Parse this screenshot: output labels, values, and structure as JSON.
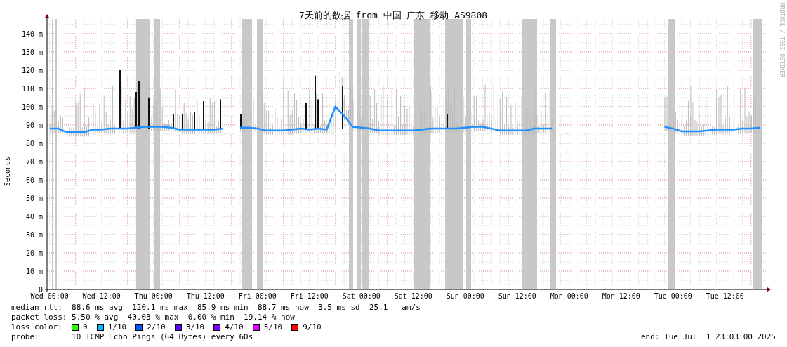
{
  "chart": {
    "credit": "RRDTOOL / TOBI OETIKER",
    "chart_data": {
      "type": "line",
      "title": "7天前的数据 from 中国 广东 移动 AS9808",
      "ylabel": "Seconds",
      "categories": [
        "Wed 00:00",
        null,
        null,
        null,
        null,
        null,
        "Wed 12:00",
        null,
        null,
        null,
        null,
        null,
        "Thu 00:00",
        null,
        null,
        null,
        null,
        null,
        "Thu 12:00",
        null,
        null,
        null,
        null,
        null,
        "Fri 00:00",
        null,
        null,
        null,
        null,
        null,
        "Fri 12:00",
        null,
        null,
        null,
        null,
        null,
        "Sat 00:00",
        null,
        null,
        null,
        null,
        null,
        "Sat 12:00",
        null,
        null,
        null,
        null,
        null,
        "Sun 00:00",
        null,
        null,
        null,
        null,
        null,
        "Sun 12:00",
        null,
        null,
        null,
        null,
        null,
        "Mon 00:00",
        null,
        null,
        null,
        null,
        null,
        "Mon 12:00",
        null,
        null,
        null,
        null,
        null,
        "Tue 00:00",
        null,
        null,
        null,
        null,
        null,
        "Tue 12:00",
        null,
        null,
        null,
        null
      ],
      "series": [
        {
          "name": "median rtt:",
          "color": "#1e90ff",
          "values": [
            88,
            88,
            86,
            86,
            86,
            87.5,
            87.5,
            88,
            88,
            88,
            88.5,
            89,
            89,
            89,
            88.5,
            87.5,
            87.5,
            87.5,
            87.5,
            87.5,
            88,
            null,
            88.5,
            88.5,
            88,
            87,
            87,
            87,
            87.5,
            88,
            87.5,
            88,
            87.5,
            100,
            95,
            89,
            88.5,
            88,
            87,
            87,
            87,
            87,
            87,
            87.5,
            88,
            88,
            88,
            88,
            88.5,
            89,
            89,
            88,
            87,
            87,
            87,
            87,
            88,
            88,
            88,
            null,
            null,
            null,
            null,
            null,
            null,
            null,
            null,
            null,
            null,
            null,
            null,
            89,
            88,
            86.5,
            86.5,
            86.5,
            87,
            87.5,
            87.5,
            87.5,
            88,
            88,
            88.5
          ]
        }
      ],
      "grid": true,
      "ylim": [
        0,
        148
      ],
      "yticks": [
        {
          "value": 0,
          "label": "0"
        },
        {
          "value": 10,
          "label": "10 m"
        },
        {
          "value": 20,
          "label": "20 m"
        },
        {
          "value": 30,
          "label": "30 m"
        },
        {
          "value": 40,
          "label": "40 m"
        },
        {
          "value": 50,
          "label": "50 m"
        },
        {
          "value": 60,
          "label": "60 m"
        },
        {
          "value": 70,
          "label": "70 m"
        },
        {
          "value": 80,
          "label": "80 m"
        },
        {
          "value": 90,
          "label": "90 m"
        },
        {
          "value": 100,
          "label": "100 m"
        },
        {
          "value": 110,
          "label": "110 m"
        },
        {
          "value": 120,
          "label": "120 m"
        },
        {
          "value": 130,
          "label": "130 m"
        },
        {
          "value": 140,
          "label": "140 m"
        }
      ]
    }
  },
  "legend": {
    "median_rtt": "88.6 ms avg  120.1 ms max  85.9 ms min  88.7 ms now  3.5 ms sd  25.1   am/s",
    "packet_loss_label": "packet loss:",
    "packet_loss": "5.50 % avg  40.03 % max  0.00 % min  19.14 % now",
    "loss_color_label": "loss color:",
    "loss_colors": [
      {
        "label": "0",
        "color": "#26ff00"
      },
      {
        "label": "1/10",
        "color": "#00b8ff"
      },
      {
        "label": "2/10",
        "color": "#0059ff"
      },
      {
        "label": "3/10",
        "color": "#5e00ff"
      },
      {
        "label": "4/10",
        "color": "#7e00ff"
      },
      {
        "label": "5/10",
        "color": "#dd00ff"
      },
      {
        "label": "9/10",
        "color": "#ff0000"
      }
    ],
    "probe_label": "probe:",
    "probe": "10 ICMP Echo Pings (64 Bytes) every 60s",
    "end": "end: Tue Jul  1 23:03:00 2025"
  }
}
